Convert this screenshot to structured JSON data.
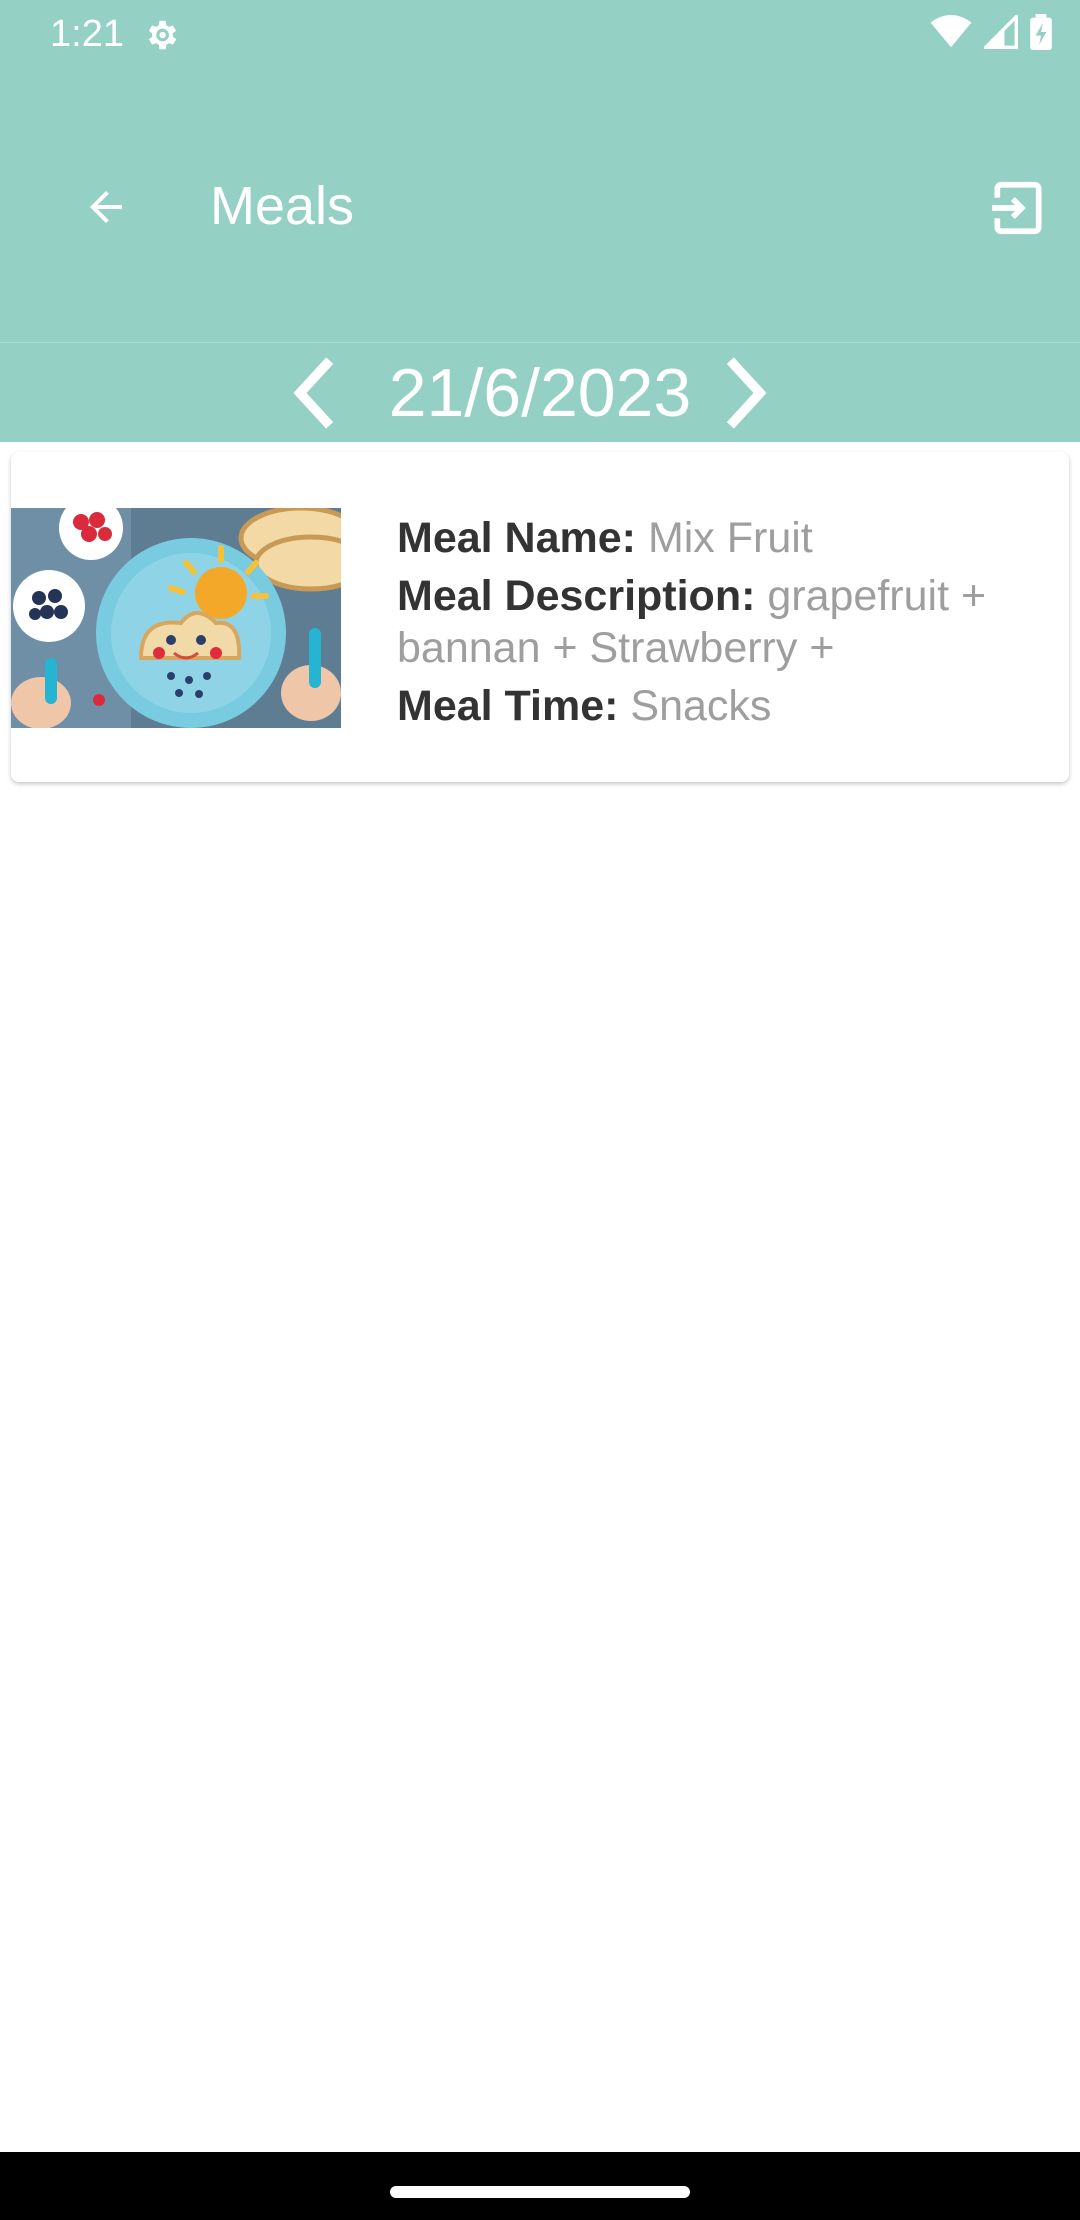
{
  "status_bar": {
    "time": "1:21",
    "icons": [
      "gear-icon",
      "wifi-icon",
      "cellular-icon",
      "battery-charging-icon"
    ]
  },
  "app_bar": {
    "title": "Meals",
    "back_icon": "back-arrow-icon",
    "exit_icon": "logout-icon"
  },
  "date_nav": {
    "date": "21/6/2023",
    "prev_icon": "chevron-left-icon",
    "next_icon": "chevron-right-icon"
  },
  "meals": [
    {
      "name_label": "Meal Name:",
      "name": "Mix Fruit",
      "description_label": "Meal Description:",
      "description": "grapefruit + bannan + Strawberry  +",
      "time_label": "Meal Time:",
      "time": "Snacks"
    }
  ],
  "colors": {
    "primary": "#94d0c4",
    "label": "#333333",
    "value": "#9e9e9e",
    "nav_bar": "#000000"
  }
}
